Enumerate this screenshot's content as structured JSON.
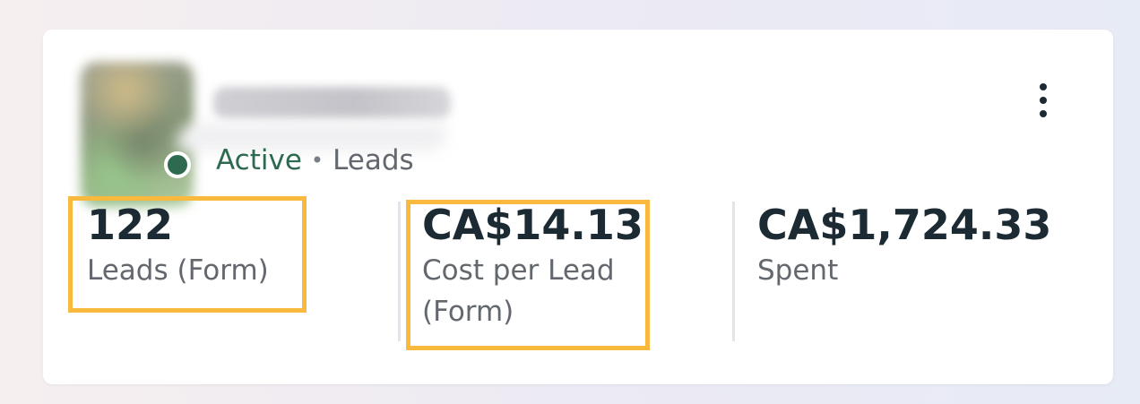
{
  "campaign": {
    "name_blurred": true,
    "status": "Active",
    "separator": "•",
    "objective": "Leads"
  },
  "colors": {
    "status_active": "#2d6a4f",
    "highlight": "#f8b93c",
    "value_text": "#1c2b33",
    "label_text": "#63676e"
  },
  "metrics": [
    {
      "value": "122",
      "label": "Leads (Form)",
      "highlighted": true
    },
    {
      "value": "CA$14.13",
      "label": "Cost per Lead (Form)",
      "highlighted": true
    },
    {
      "value": "CA$1,724.33",
      "label": "Spent",
      "highlighted": false
    }
  ],
  "menu": {
    "icon": "more-vertical-icon"
  }
}
